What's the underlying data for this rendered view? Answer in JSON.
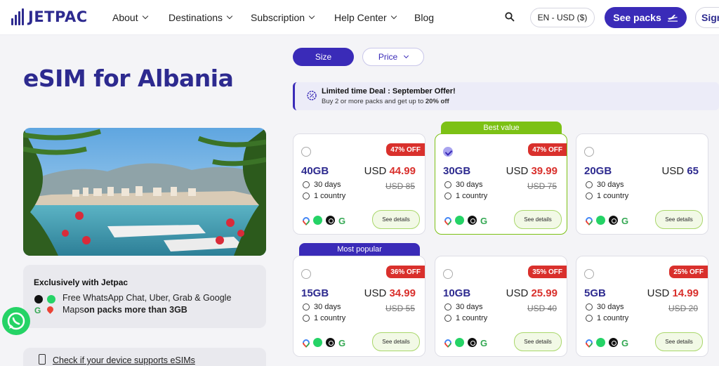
{
  "nav": {
    "logo": "JETPAC",
    "items": [
      {
        "label": "About",
        "has_dropdown": true
      },
      {
        "label": "Destinations",
        "has_dropdown": true
      },
      {
        "label": "Subscription",
        "has_dropdown": true
      },
      {
        "label": "Help Center",
        "has_dropdown": true
      },
      {
        "label": "Blog",
        "has_dropdown": false
      }
    ],
    "search_icon": "search-icon",
    "language_currency": "EN - USD ($)",
    "see_packs": "See packs",
    "sign_in": "Sign"
  },
  "page": {
    "title": "eSIM for Albania",
    "hero_image": "albania-coast-photo"
  },
  "exclusive": {
    "title": "Exclusively with Jetpac",
    "line1": "Free WhatsApp Chat, Uber, Grab & Google",
    "line2_prefix": "Maps",
    "line2_bold": "on packs more than 3GB"
  },
  "device_check": "Check if your device supports eSIMs",
  "filters": {
    "size": "Size",
    "price": "Price"
  },
  "deal": {
    "title": "Limited time Deal : September Offer!",
    "sub_prefix": "Buy 2 or more packs and get up to ",
    "sub_bold": "20% off"
  },
  "banners": {
    "best_value": "Best value",
    "most_popular": "Most popular"
  },
  "packs": [
    {
      "size": "40GB",
      "currency": "USD",
      "price": "44.99",
      "original": "USD 85",
      "discount": "47% OFF",
      "duration": "30 days",
      "coverage": "1 country",
      "selected": false,
      "details": "See details"
    },
    {
      "size": "30GB",
      "currency": "USD",
      "price": "39.99",
      "original": "USD 75",
      "discount": "47% OFF",
      "duration": "30 days",
      "coverage": "1 country",
      "selected": true,
      "details": "See details"
    },
    {
      "size": "20GB",
      "currency": "USD",
      "price": "65",
      "original": "",
      "discount": "",
      "duration": "30 days",
      "coverage": "1 country",
      "selected": false,
      "details": "See details"
    },
    {
      "size": "15GB",
      "currency": "USD",
      "price": "34.99",
      "original": "USD 55",
      "discount": "36% OFF",
      "duration": "30 days",
      "coverage": "1 country",
      "selected": false,
      "details": "See details"
    },
    {
      "size": "10GB",
      "currency": "USD",
      "price": "25.99",
      "original": "USD 40",
      "discount": "35% OFF",
      "duration": "30 days",
      "coverage": "1 country",
      "selected": false,
      "details": "See details"
    },
    {
      "size": "5GB",
      "currency": "USD",
      "price": "14.99",
      "original": "USD 20",
      "discount": "25% OFF",
      "duration": "30 days",
      "coverage": "1 country",
      "selected": false,
      "details": "See details"
    }
  ],
  "pack_apps": [
    "google-maps-icon",
    "whatsapp-icon",
    "uber-icon",
    "google-icon"
  ],
  "colors": {
    "brand": "#2d2a8f",
    "accent": "#3a2bb8",
    "discount": "#d9302c",
    "best_value": "#7cc115",
    "whatsapp": "#25d366"
  }
}
